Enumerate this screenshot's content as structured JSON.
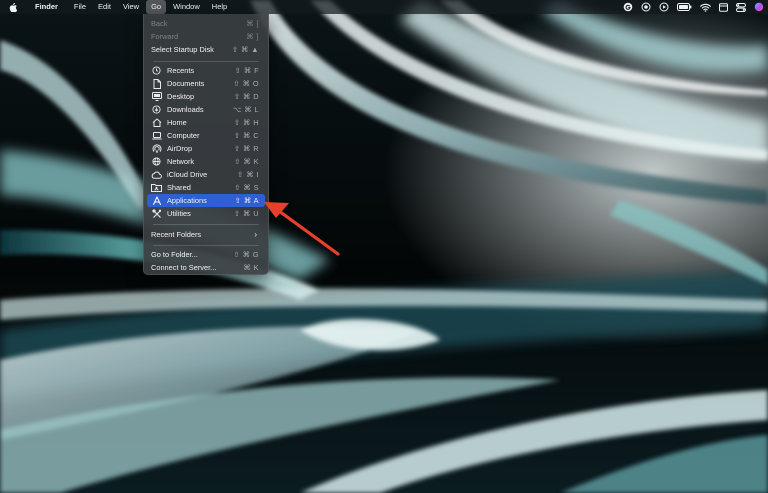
{
  "menubar": {
    "apple_icon": "apple-logo-icon",
    "app_name": "Finder",
    "menus": [
      "File",
      "Edit",
      "View",
      "Go",
      "Window",
      "Help"
    ],
    "active_menu": "Go",
    "status_icons": [
      "grammarly-icon",
      "screen-record-icon",
      "play-circle-icon",
      "battery-icon",
      "wifi-icon",
      "window-icon",
      "control-center-icon",
      "siri-icon"
    ]
  },
  "go_menu": {
    "items": [
      {
        "label": "Back",
        "shortcut": "⌘ [",
        "enabled": false,
        "icon": null
      },
      {
        "label": "Forward",
        "shortcut": "⌘ ]",
        "enabled": false,
        "icon": null
      },
      {
        "label": "Select Startup Disk",
        "shortcut": "⇧ ⌘ ▲",
        "enabled": true,
        "icon": null
      },
      {
        "label": "Recents",
        "shortcut": "⇧ ⌘ F",
        "enabled": true,
        "icon": "clock-icon"
      },
      {
        "label": "Documents",
        "shortcut": "⇧ ⌘ O",
        "enabled": true,
        "icon": "document-icon"
      },
      {
        "label": "Desktop",
        "shortcut": "⇧ ⌘ D",
        "enabled": true,
        "icon": "desktop-icon"
      },
      {
        "label": "Downloads",
        "shortcut": "⌥ ⌘ L",
        "enabled": true,
        "icon": "download-icon"
      },
      {
        "label": "Home",
        "shortcut": "⇧ ⌘ H",
        "enabled": true,
        "icon": "home-icon"
      },
      {
        "label": "Computer",
        "shortcut": "⇧ ⌘ C",
        "enabled": true,
        "icon": "laptop-icon"
      },
      {
        "label": "AirDrop",
        "shortcut": "⇧ ⌘ R",
        "enabled": true,
        "icon": "airdrop-icon"
      },
      {
        "label": "Network",
        "shortcut": "⇧ ⌘ K",
        "enabled": true,
        "icon": "globe-icon"
      },
      {
        "label": "iCloud Drive",
        "shortcut": "⇧ ⌘ I",
        "enabled": true,
        "icon": "cloud-icon"
      },
      {
        "label": "Shared",
        "shortcut": "⇧ ⌘ S",
        "enabled": true,
        "icon": "shared-folder-icon"
      },
      {
        "label": "Applications",
        "shortcut": "⇧ ⌘ A",
        "enabled": true,
        "selected": true,
        "icon": "applications-icon"
      },
      {
        "label": "Utilities",
        "shortcut": "⇧ ⌘ U",
        "enabled": true,
        "icon": "utilities-icon"
      },
      {
        "label": "Recent Folders",
        "shortcut": "›",
        "enabled": true,
        "icon": null
      },
      {
        "label": "Go to Folder...",
        "shortcut": "⇧ ⌘ G",
        "enabled": true,
        "icon": null
      },
      {
        "label": "Connect to Server...",
        "shortcut": "⌘ K",
        "enabled": true,
        "icon": null
      }
    ]
  },
  "annotation": {
    "type": "arrow",
    "color": "#e8402a",
    "points_to": "Applications"
  },
  "colors": {
    "highlight": "#2e5fd3",
    "menu_bg": "#3a3e42",
    "arrow": "#e8402a"
  }
}
